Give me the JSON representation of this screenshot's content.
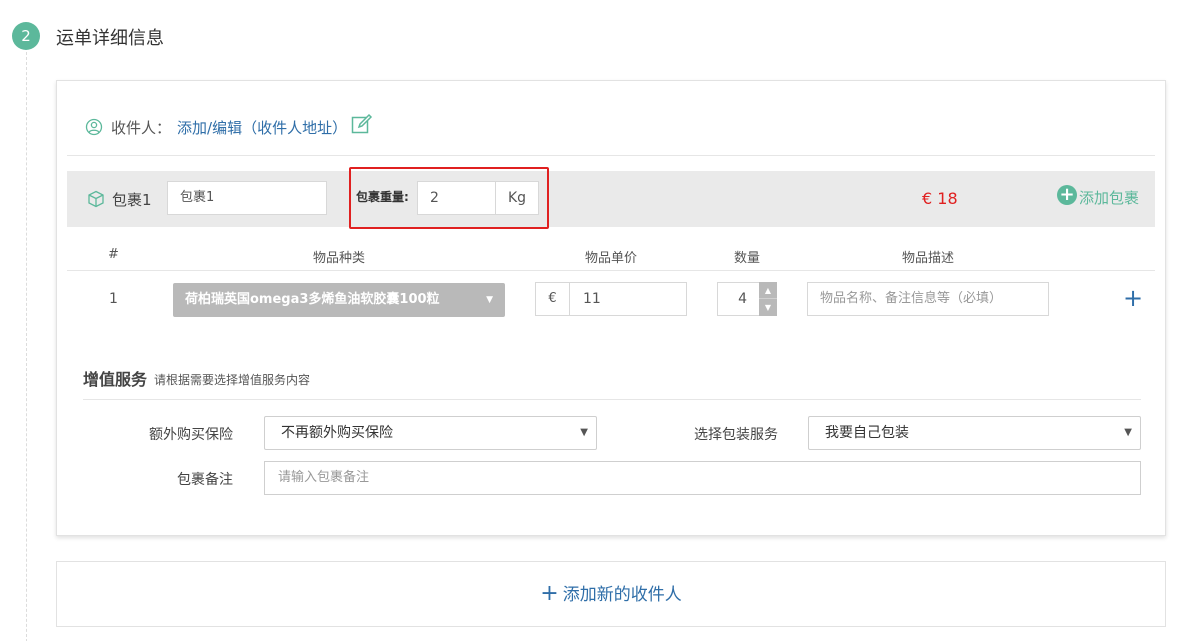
{
  "step": {
    "number": "2",
    "title": "运单详细信息"
  },
  "recipient": {
    "label": "收件人：",
    "link": "添加/编辑（收件人地址）",
    "person_icon": "user-circle-icon",
    "edit_icon": "edit-icon"
  },
  "package": {
    "label": "包裹1",
    "name_value": "包裹1",
    "weight_label": "包裹重量:",
    "weight_value": "2",
    "weight_unit": "Kg",
    "price": "€ 18",
    "add_label": "添加包裹",
    "package_icon": "box-icon"
  },
  "items_table": {
    "headers": [
      "#",
      "物品种类",
      "物品单价",
      "数量",
      "物品描述"
    ],
    "rows": [
      {
        "index": "1",
        "category": "荷柏瑞英国omega3多烯鱼油软胶囊100粒",
        "currency": "€",
        "price": "11",
        "quantity": "4",
        "description_placeholder": "物品名称、备注信息等（必填）"
      }
    ],
    "add_row_label": "+"
  },
  "value_added": {
    "title": "增值服务",
    "subtitle": "请根据需要选择增值服务内容",
    "insurance_label": "额外购买保险",
    "insurance_value": "不再额外购买保险",
    "packing_label": "选择包装服务",
    "packing_value": "我要自己包装",
    "remark_label": "包裹备注",
    "remark_placeholder": "请输入包裹备注"
  },
  "add_recipient": {
    "plus": "+",
    "label": "添加新的收件人"
  },
  "colors": {
    "accent_green": "#5cb89b",
    "link_blue": "#2f6ea8",
    "price_red": "#e02020",
    "highlight_red": "#e02020"
  }
}
